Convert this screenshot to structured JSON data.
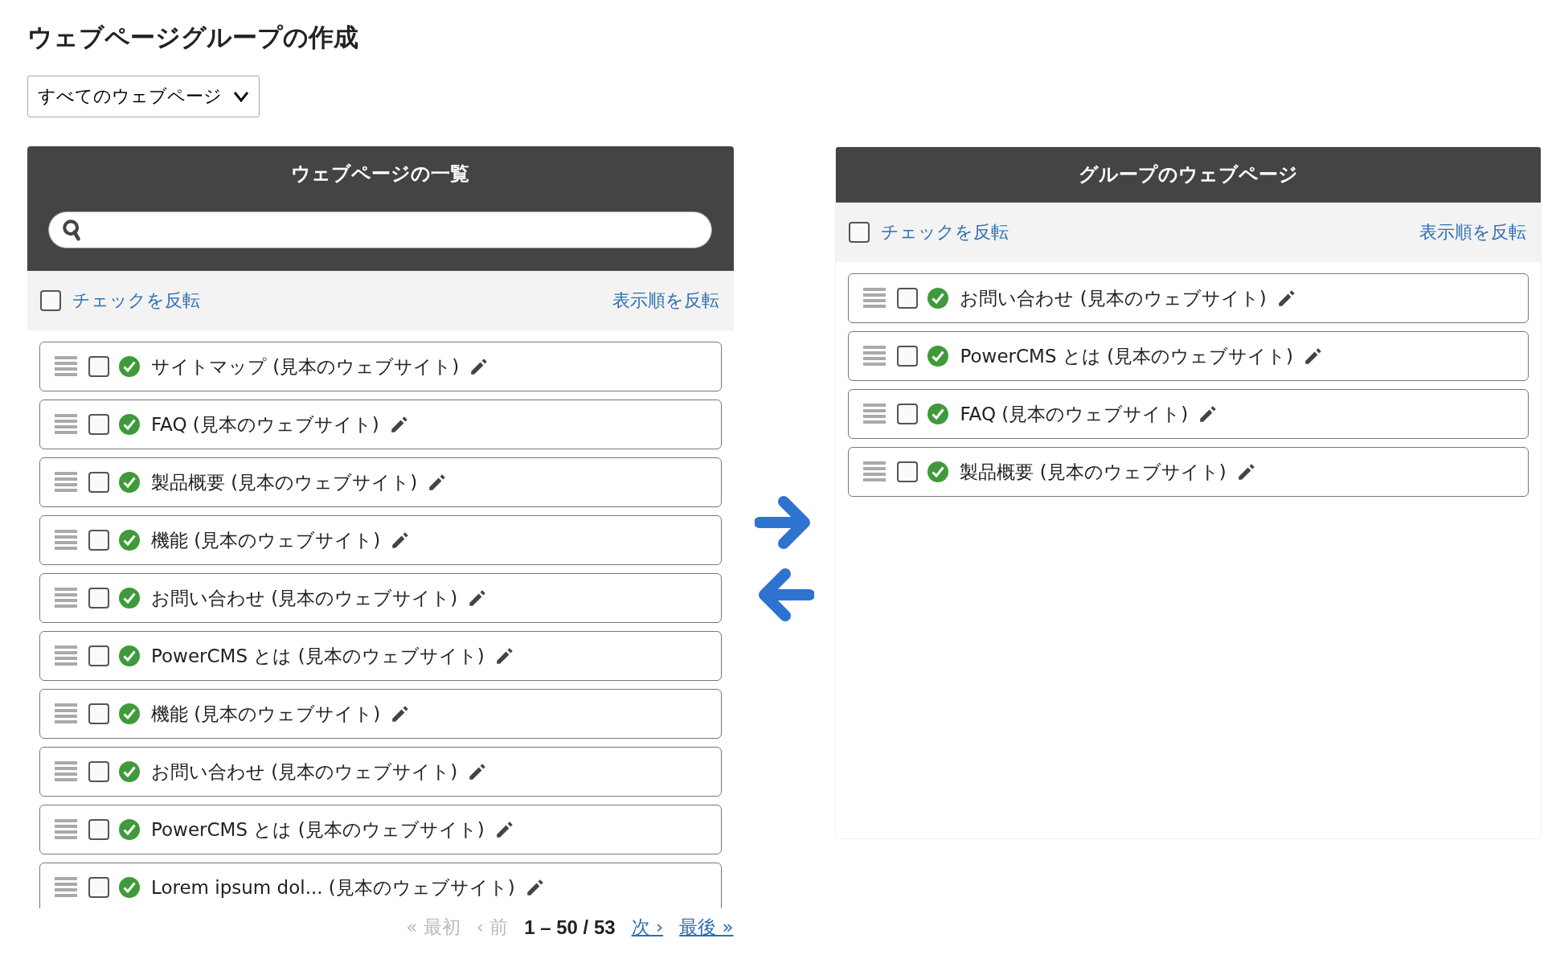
{
  "page_title": "ウェブページグループの作成",
  "filter_dropdown": {
    "value": "すべてのウェブページ"
  },
  "left_panel": {
    "title": "ウェブページの一覧",
    "toolbar": {
      "select_all_checked": false,
      "invert_check": "チェックを反転",
      "invert_order": "表示順を反転"
    },
    "items": [
      {
        "label": "サイトマップ (見本のウェブサイト)",
        "checked": false,
        "published": true
      },
      {
        "label": "FAQ (見本のウェブサイト)",
        "checked": false,
        "published": true
      },
      {
        "label": "製品概要 (見本のウェブサイト)",
        "checked": false,
        "published": true
      },
      {
        "label": "機能 (見本のウェブサイト)",
        "checked": false,
        "published": true
      },
      {
        "label": "お問い合わせ (見本のウェブサイト)",
        "checked": false,
        "published": true
      },
      {
        "label": "PowerCMS とは (見本のウェブサイト)",
        "checked": false,
        "published": true
      },
      {
        "label": "機能 (見本のウェブサイト)",
        "checked": false,
        "published": true
      },
      {
        "label": "お問い合わせ (見本のウェブサイト)",
        "checked": false,
        "published": true
      },
      {
        "label": "PowerCMS とは (見本のウェブサイト)",
        "checked": false,
        "published": true
      },
      {
        "label": "Lorem ipsum dol... (見本のウェブサイト)",
        "checked": false,
        "published": true
      }
    ],
    "pagination": {
      "links": [
        {
          "label": "« 最初",
          "disabled": true
        },
        {
          "label": "‹ 前",
          "disabled": true
        },
        {
          "label": "次 ›",
          "disabled": false
        },
        {
          "label": "最後 »",
          "disabled": false
        }
      ],
      "range": "1 – 50 / 53"
    }
  },
  "right_panel": {
    "title": "グループのウェブページ",
    "toolbar": {
      "select_all_checked": false,
      "invert_check": "チェックを反転",
      "invert_order": "表示順を反転"
    },
    "items": [
      {
        "label": "お問い合わせ (見本のウェブサイト)",
        "checked": false,
        "published": true
      },
      {
        "label": "PowerCMS とは (見本のウェブサイト)",
        "checked": false,
        "published": true
      },
      {
        "label": "FAQ (見本のウェブサイト)",
        "checked": false,
        "published": true
      },
      {
        "label": "製品概要 (見本のウェブサイト)",
        "checked": false,
        "published": true
      }
    ]
  }
}
